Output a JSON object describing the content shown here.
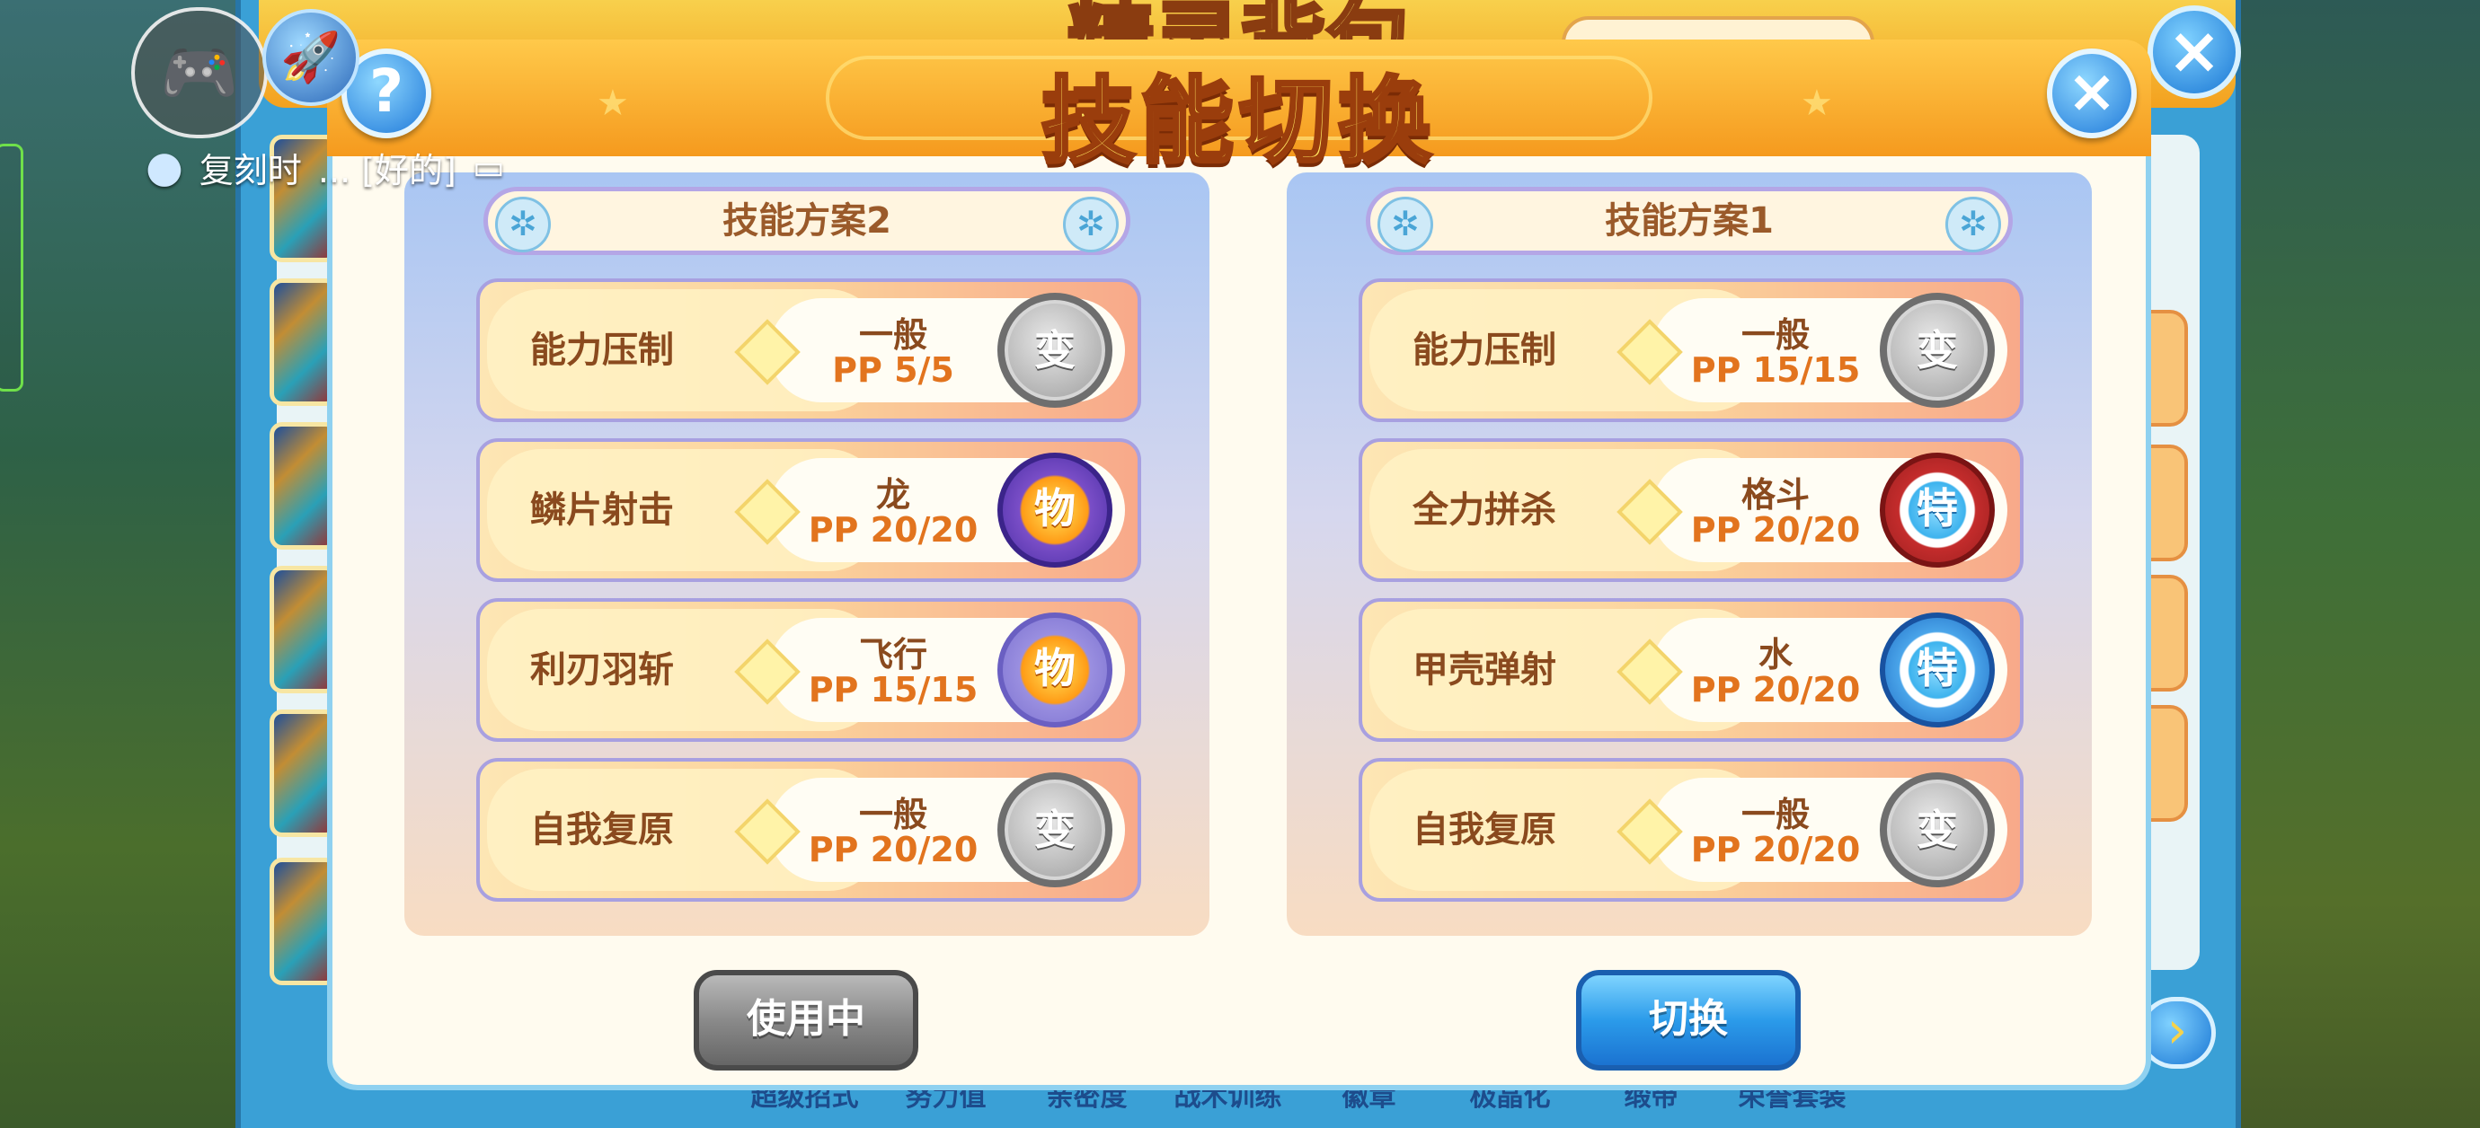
{
  "background": {
    "title": "精灵背包",
    "bottom_tabs": [
      "超级招式",
      "努力值",
      "亲密度",
      "战术训练",
      "徽章",
      "极晶化",
      "缎带",
      "荣誉套装"
    ]
  },
  "overlay": {
    "chat_text": "复刻时",
    "chat_quote": "...  [好的]"
  },
  "dialog": {
    "title": "技能切换",
    "help_icon": "?",
    "close_icon": "×",
    "plans": [
      {
        "title": "技能方案2",
        "skills": [
          {
            "name": "能力压制",
            "type": "一般",
            "pp": "PP 5/5",
            "category": "变",
            "category_style": "status"
          },
          {
            "name": "鳞片射击",
            "type": "龙",
            "pp": "PP 20/20",
            "category": "物",
            "category_style": "physical"
          },
          {
            "name": "利刃羽斩",
            "type": "飞行",
            "pp": "PP 15/15",
            "category": "物",
            "category_style": "physical-light"
          },
          {
            "name": "自我复原",
            "type": "一般",
            "pp": "PP 20/20",
            "category": "变",
            "category_style": "status"
          }
        ],
        "button": "使用中"
      },
      {
        "title": "技能方案1",
        "skills": [
          {
            "name": "能力压制",
            "type": "一般",
            "pp": "PP 15/15",
            "category": "变",
            "category_style": "status"
          },
          {
            "name": "全力拼杀",
            "type": "格斗",
            "pp": "PP 20/20",
            "category": "特",
            "category_style": "special-red"
          },
          {
            "name": "甲壳弹射",
            "type": "水",
            "pp": "PP 20/20",
            "category": "特",
            "category_style": "special-blue"
          },
          {
            "name": "自我复原",
            "type": "一般",
            "pp": "PP 20/20",
            "category": "变",
            "category_style": "status"
          }
        ],
        "button": "切换"
      }
    ]
  }
}
